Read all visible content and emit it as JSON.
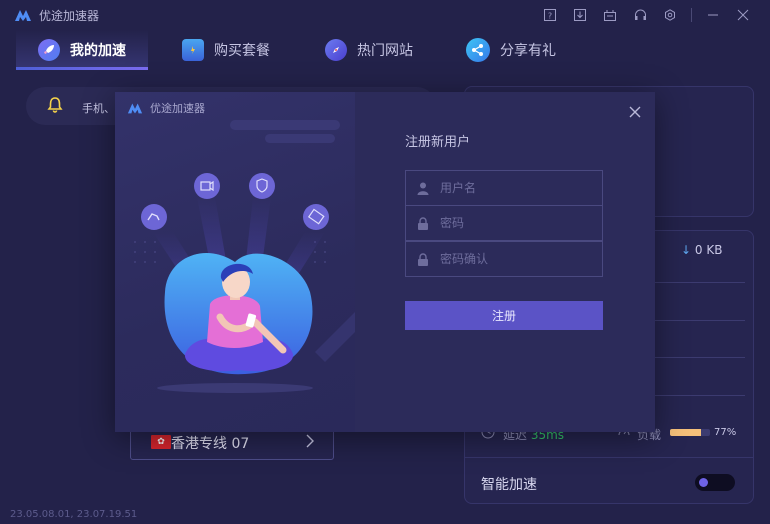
{
  "app": {
    "name": "优途加速器",
    "version": "23.05.08.01, 23.07.19.51"
  },
  "nav": {
    "tabs": [
      {
        "label": "我的加速",
        "icon": "rocket-icon",
        "active": true
      },
      {
        "label": "购买套餐",
        "icon": "shopping-bag-icon",
        "active": false
      },
      {
        "label": "热门网站",
        "icon": "compass-icon",
        "active": false
      },
      {
        "label": "分享有礼",
        "icon": "share-icon",
        "active": false
      }
    ]
  },
  "window_controls": [
    "help-icon",
    "download-icon",
    "gift-box-icon",
    "headset-icon",
    "settings-icon",
    "minimize-icon",
    "close-icon"
  ],
  "notice": {
    "text": "手机、"
  },
  "stats": {
    "download_speed": "0 KB",
    "latency_label": "延迟",
    "latency_value": "35ms",
    "load_label": "负载",
    "load_percent": "77%",
    "load_fraction": 0.77
  },
  "smart_accel": {
    "label": "智能加速",
    "enabled": false
  },
  "server": {
    "name": "香港专线 07",
    "flag": "hong-kong-flag"
  },
  "modal": {
    "app_name": "优途加速器",
    "title": "注册新用户",
    "username_placeholder": "用户名",
    "password_placeholder": "密码",
    "confirm_placeholder": "密码确认",
    "submit_label": "注册"
  },
  "colors": {
    "background": "#23224a",
    "accent": "#5b53c6",
    "latency": "#35c86b",
    "load": "#f5c07a"
  }
}
